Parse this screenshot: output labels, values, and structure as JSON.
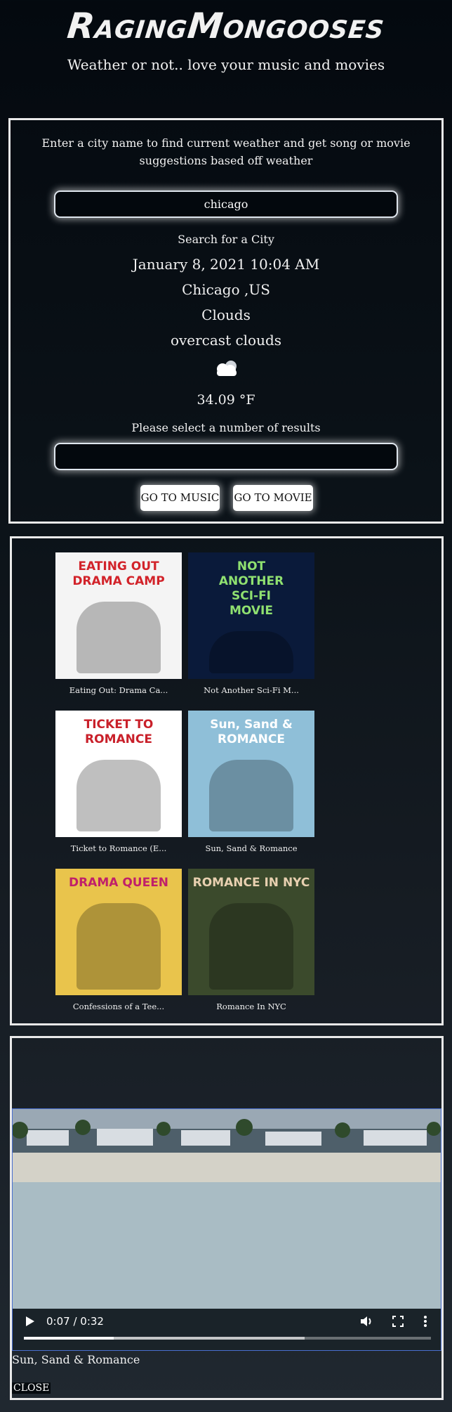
{
  "header": {
    "logo": "RagingMongooses",
    "tagline": "Weather or not.. love your music and movies"
  },
  "search": {
    "intro": "Enter a city name to find current weather and get song or movie suggestions based off weather",
    "city_value": "chicago",
    "results_value": "",
    "status": "Search for a City",
    "datetime": "January 8, 2021 10:04 AM",
    "city": "Chicago ,US",
    "condition": "Clouds",
    "description": "overcast clouds",
    "weather_icon": "cloud-icon",
    "temperature": "34.09 °F",
    "results_prompt": "Please select a number of results",
    "music_button": "GO TO MUSIC",
    "movie_button": "GO TO MOVIE"
  },
  "movies": [
    {
      "caption": "Eating Out: Drama Ca...",
      "poster_text": [
        "EATING OUT",
        "DRAMA CAMP"
      ],
      "bg": "#f4f4f4",
      "fg": "#d2232a"
    },
    {
      "caption": "Not Another Sci-Fi M...",
      "poster_text": [
        "NOT",
        "ANOTHER",
        "SCI-FI",
        "MOVIE"
      ],
      "bg": "#0a1a3a",
      "fg": "#8fe070"
    },
    {
      "caption": "Ticket to Romance (E...",
      "poster_text": [
        "TICKET TO",
        "ROMANCE"
      ],
      "bg": "#ffffff",
      "fg": "#c9202a"
    },
    {
      "caption": "Sun, Sand & Romance",
      "poster_text": [
        "Sun, Sand &",
        "ROMANCE"
      ],
      "bg": "#8fbfd8",
      "fg": "#ffffff"
    },
    {
      "caption": "Confessions of a Tee...",
      "poster_text": [
        "DRAMA QUEEN"
      ],
      "bg": "#e9c44c",
      "fg": "#c0206a"
    },
    {
      "caption": "Romance In NYC",
      "poster_text": [
        "ROMANCE IN NYC"
      ],
      "bg": "#3b4a2c",
      "fg": "#e8d0b0"
    }
  ],
  "video": {
    "time": "0:07 / 0:32",
    "progress": 0.22,
    "buffered": 0.69,
    "title": "Sun, Sand & Romance",
    "close_label": "CLOSE"
  }
}
